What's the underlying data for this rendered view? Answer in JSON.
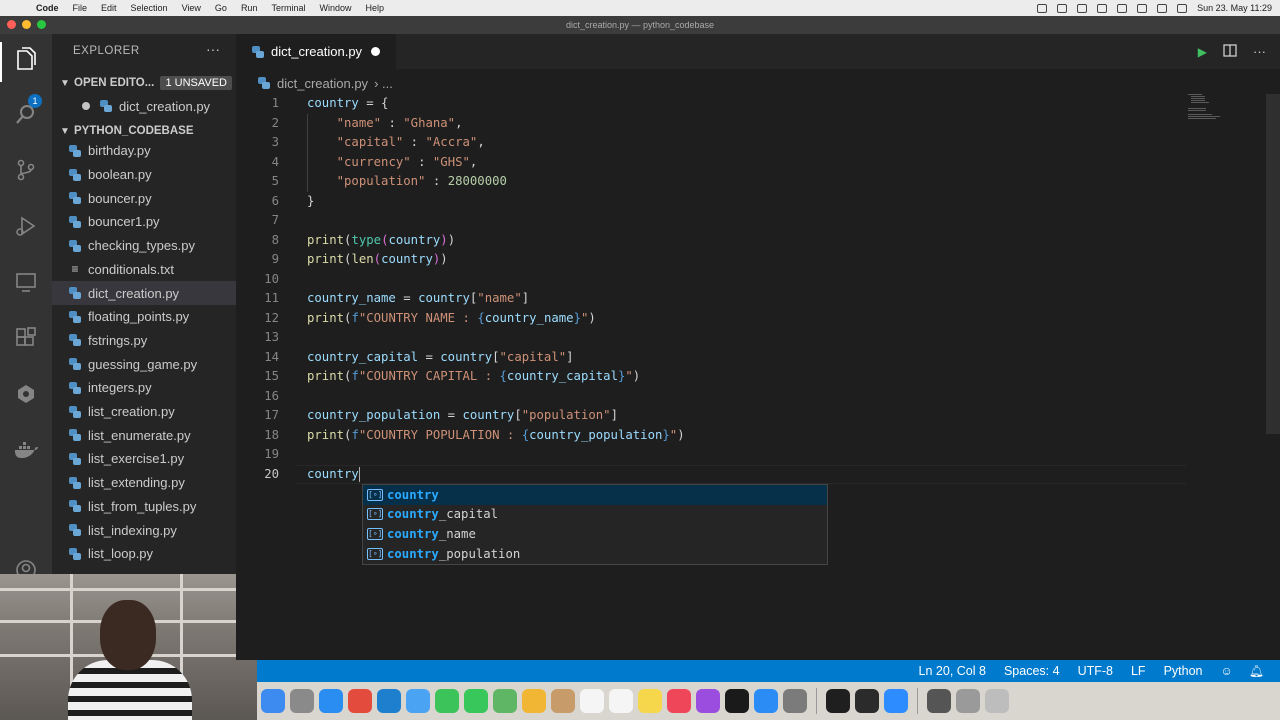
{
  "menubar": {
    "app": "Code",
    "items": [
      "File",
      "Edit",
      "Selection",
      "View",
      "Go",
      "Run",
      "Terminal",
      "Window",
      "Help"
    ],
    "clock": "Sun 23. May 11:29"
  },
  "window": {
    "title": "dict_creation.py — python_codebase"
  },
  "activity": {
    "badge": "1"
  },
  "sidebar": {
    "title": "EXPLORER",
    "more": "···",
    "open_editors": {
      "label": "OPEN EDITO...",
      "badge": "1 UNSAVED",
      "file": "dict_creation.py"
    },
    "folder": {
      "label": "PYTHON_CODEBASE"
    },
    "files": [
      {
        "name": "birthday.py",
        "type": "py"
      },
      {
        "name": "boolean.py",
        "type": "py"
      },
      {
        "name": "bouncer.py",
        "type": "py"
      },
      {
        "name": "bouncer1.py",
        "type": "py"
      },
      {
        "name": "checking_types.py",
        "type": "py"
      },
      {
        "name": "conditionals.txt",
        "type": "txt"
      },
      {
        "name": "dict_creation.py",
        "type": "py",
        "active": true
      },
      {
        "name": "floating_points.py",
        "type": "py"
      },
      {
        "name": "fstrings.py",
        "type": "py"
      },
      {
        "name": "guessing_game.py",
        "type": "py"
      },
      {
        "name": "integers.py",
        "type": "py"
      },
      {
        "name": "list_creation.py",
        "type": "py"
      },
      {
        "name": "list_enumerate.py",
        "type": "py"
      },
      {
        "name": "list_exercise1.py",
        "type": "py"
      },
      {
        "name": "list_extending.py",
        "type": "py"
      },
      {
        "name": "list_from_tuples.py",
        "type": "py"
      },
      {
        "name": "list_indexing.py",
        "type": "py"
      },
      {
        "name": "list_loop.py",
        "type": "py"
      }
    ]
  },
  "editor": {
    "tab": "dict_creation.py",
    "breadcrumb": {
      "file": "dict_creation.py",
      "rest": "›  ..."
    },
    "current_line": 20,
    "lines": [
      [
        [
          "v",
          "country"
        ],
        [
          "p",
          " = {"
        ]
      ],
      [
        [
          "p",
          "    "
        ],
        [
          "s",
          "\"name\""
        ],
        [
          "p",
          " : "
        ],
        [
          "s",
          "\"Ghana\""
        ],
        [
          "p",
          ","
        ]
      ],
      [
        [
          "p",
          "    "
        ],
        [
          "s",
          "\"capital\""
        ],
        [
          "p",
          " : "
        ],
        [
          "s",
          "\"Accra\""
        ],
        [
          "p",
          ","
        ]
      ],
      [
        [
          "p",
          "    "
        ],
        [
          "s",
          "\"currency\""
        ],
        [
          "p",
          " : "
        ],
        [
          "s",
          "\"GHS\""
        ],
        [
          "p",
          ","
        ]
      ],
      [
        [
          "p",
          "    "
        ],
        [
          "s",
          "\"population\""
        ],
        [
          "p",
          " : "
        ],
        [
          "n",
          "28000000"
        ]
      ],
      [
        [
          "p",
          "}"
        ]
      ],
      [],
      [
        [
          "f",
          "print"
        ],
        [
          "p",
          "("
        ],
        [
          "b",
          "type"
        ],
        [
          "br",
          "("
        ],
        [
          "v",
          "country"
        ],
        [
          "br",
          ")"
        ],
        [
          "p",
          ")"
        ]
      ],
      [
        [
          "f",
          "print"
        ],
        [
          "p",
          "("
        ],
        [
          "f",
          "len"
        ],
        [
          "br",
          "("
        ],
        [
          "v",
          "country"
        ],
        [
          "br",
          ")"
        ],
        [
          "p",
          ")"
        ]
      ],
      [],
      [
        [
          "v",
          "country_name"
        ],
        [
          "p",
          " = "
        ],
        [
          "v",
          "country"
        ],
        [
          "p",
          "["
        ],
        [
          "s",
          "\"name\""
        ],
        [
          "p",
          "]"
        ]
      ],
      [
        [
          "f",
          "print"
        ],
        [
          "p",
          "("
        ],
        [
          "c",
          "f"
        ],
        [
          "s",
          "\"COUNTRY NAME : "
        ],
        [
          "c",
          "{"
        ],
        [
          "v",
          "country_name"
        ],
        [
          "c",
          "}"
        ],
        [
          "s",
          "\""
        ],
        [
          "p",
          ")"
        ]
      ],
      [],
      [
        [
          "v",
          "country_capital"
        ],
        [
          "p",
          " = "
        ],
        [
          "v",
          "country"
        ],
        [
          "p",
          "["
        ],
        [
          "s",
          "\"capital\""
        ],
        [
          "p",
          "]"
        ]
      ],
      [
        [
          "f",
          "print"
        ],
        [
          "p",
          "("
        ],
        [
          "c",
          "f"
        ],
        [
          "s",
          "\"COUNTRY CAPITAL : "
        ],
        [
          "c",
          "{"
        ],
        [
          "v",
          "country_capital"
        ],
        [
          "c",
          "}"
        ],
        [
          "s",
          "\""
        ],
        [
          "p",
          ")"
        ]
      ],
      [],
      [
        [
          "v",
          "country_population"
        ],
        [
          "p",
          " = "
        ],
        [
          "v",
          "country"
        ],
        [
          "p",
          "["
        ],
        [
          "s",
          "\"population\""
        ],
        [
          "p",
          "]"
        ]
      ],
      [
        [
          "f",
          "print"
        ],
        [
          "p",
          "("
        ],
        [
          "c",
          "f"
        ],
        [
          "s",
          "\"COUNTRY POPULATION : "
        ],
        [
          "c",
          "{"
        ],
        [
          "v",
          "country_population"
        ],
        [
          "c",
          "}"
        ],
        [
          "s",
          "\""
        ],
        [
          "p",
          ")"
        ]
      ],
      [],
      [
        [
          "v",
          "country"
        ]
      ]
    ]
  },
  "suggest": {
    "typed": "country",
    "items": [
      {
        "match": "country",
        "rest": ""
      },
      {
        "match": "country",
        "rest": "_capital"
      },
      {
        "match": "country",
        "rest": "_name"
      },
      {
        "match": "country",
        "rest": "_population"
      }
    ],
    "icon": "[⊘]"
  },
  "statusbar": {
    "position": "Ln 20, Col 8",
    "spaces": "Spaces: 4",
    "encoding": "UTF-8",
    "eol": "LF",
    "language": "Python"
  },
  "dock": {
    "apps": [
      {
        "name": "finder",
        "color": "#3d8bf0"
      },
      {
        "name": "launchpad",
        "color": "#8a8a8a"
      },
      {
        "name": "safari",
        "color": "#2a8df2"
      },
      {
        "name": "chrome",
        "color": "#e34c3c"
      },
      {
        "name": "vscode",
        "color": "#1f7fcf"
      },
      {
        "name": "mail",
        "color": "#4aa3f3"
      },
      {
        "name": "facetime",
        "color": "#3cc35a"
      },
      {
        "name": "messages",
        "color": "#38c75a"
      },
      {
        "name": "maps",
        "color": "#5fb765"
      },
      {
        "name": "photos",
        "color": "#f2b635"
      },
      {
        "name": "contacts",
        "color": "#c79b6a"
      },
      {
        "name": "calendar",
        "color": "#f5f5f5"
      },
      {
        "name": "reminders",
        "color": "#f5f5f5"
      },
      {
        "name": "notes",
        "color": "#f6d64a"
      },
      {
        "name": "music",
        "color": "#f0465a"
      },
      {
        "name": "podcasts",
        "color": "#9b4de0"
      },
      {
        "name": "appletv",
        "color": "#1a1a1a"
      },
      {
        "name": "appstore",
        "color": "#2b8cf5"
      },
      {
        "name": "system-preferences",
        "color": "#7b7b7b"
      },
      {
        "name": "terminal",
        "color": "#1f1f1f"
      },
      {
        "name": "github",
        "color": "#2b2b2b"
      },
      {
        "name": "zoom",
        "color": "#2d8cff"
      },
      {
        "name": "screenshot-app",
        "color": "#555555"
      },
      {
        "name": "document-app",
        "color": "#9a9a9a"
      },
      {
        "name": "trash",
        "color": "#bdbdbd"
      }
    ]
  }
}
